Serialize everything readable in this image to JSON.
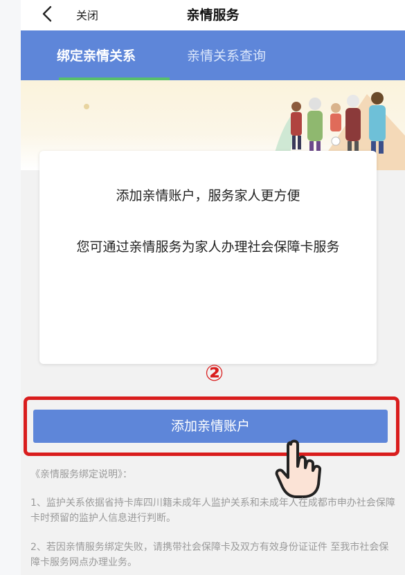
{
  "navbar": {
    "back_icon": "chevron-left-icon",
    "close_label": "关闭",
    "title": "亲情服务"
  },
  "tabs": [
    {
      "label": "绑定亲情关系",
      "active": true
    },
    {
      "label": "亲情关系查询",
      "active": false
    }
  ],
  "banner": {
    "illustration": "family-illustration"
  },
  "card": {
    "line1": "添加亲情账户，服务家人更方便",
    "line2": "您可通过亲情服务为家人办理社会保障卡服务"
  },
  "annotation": {
    "step_number": "②",
    "highlight_color": "#d91d1d",
    "pointer_icon": "hand-pointer-icon"
  },
  "primary_button": {
    "label": "添加亲情账户"
  },
  "notes": {
    "title": "《亲情服务绑定说明》：",
    "items": [
      "1、监护关系依据省持卡库四川籍未成年人监护关系和未成年人在成都市申办社会保障卡时预留的监护人信息进行判断。",
      "2、若因亲情服务绑定失败，请携带社会保障卡及双方有效身份证证件 至我市社会保障卡服务网点办理业务。"
    ]
  },
  "colors": {
    "accent": "#5e86d9",
    "tab_indicator": "#58c06a"
  }
}
